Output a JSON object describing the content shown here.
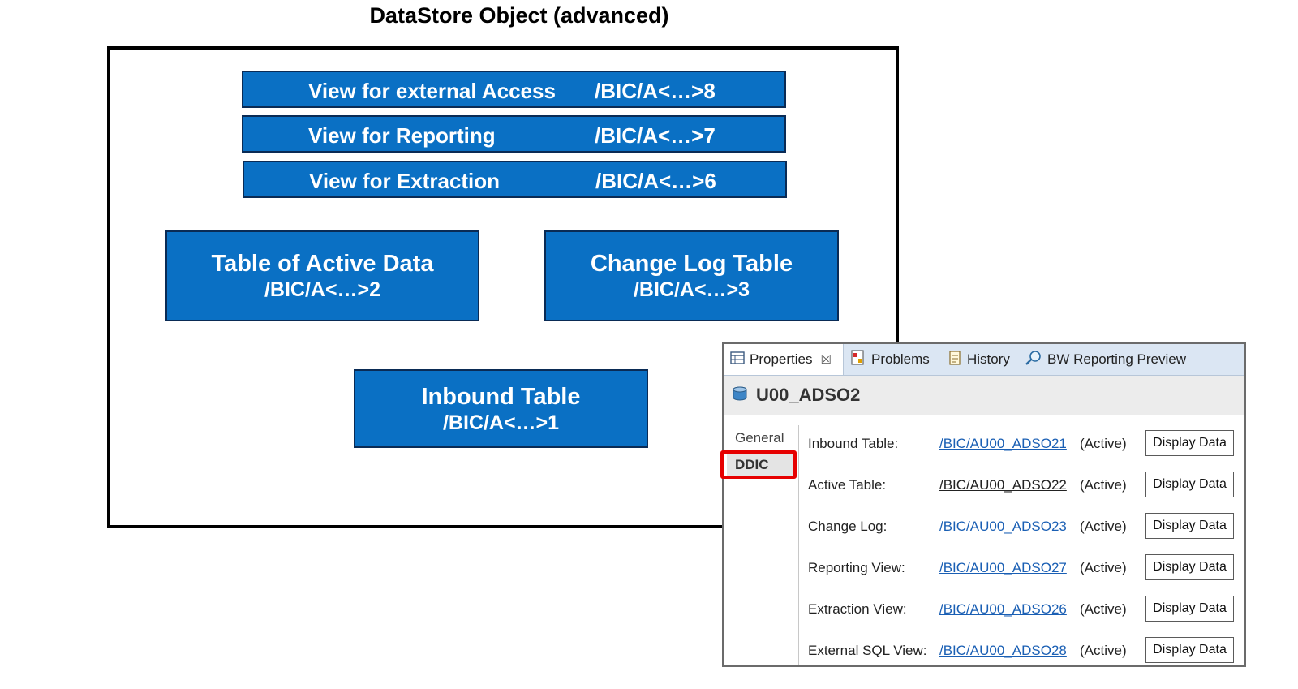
{
  "title": "DataStore Object (advanced)",
  "views": [
    {
      "label": "View for external Access",
      "code": "/BIC/A<…>8"
    },
    {
      "label": "View for Reporting",
      "code": "/BIC/A<…>7"
    },
    {
      "label": "View for Extraction",
      "code": "/BIC/A<…>6"
    }
  ],
  "tables": {
    "active": {
      "name": "Table of Active Data",
      "code": "/BIC/A<…>2"
    },
    "changelog": {
      "name": "Change Log Table",
      "code": "/BIC/A<…>3"
    },
    "inbound": {
      "name": "Inbound Table",
      "code": "/BIC/A<…>1"
    }
  },
  "panel": {
    "tabs": [
      {
        "label": "Properties",
        "icon": "properties-icon"
      },
      {
        "label": "Problems",
        "icon": "problems-icon"
      },
      {
        "label": "History",
        "icon": "history-icon"
      },
      {
        "label": "BW Reporting Preview",
        "icon": "reporting-preview-icon"
      }
    ],
    "close_glyph": "☒",
    "object_name": "U00_ADSO2",
    "side_tabs": [
      "General",
      "DDIC"
    ],
    "selected_side_tab": "DDIC",
    "rows": [
      {
        "label": "Inbound Table:",
        "link": "/BIC/AU00_ADSO21",
        "status": "(Active)",
        "button": "Display Data"
      },
      {
        "label": "Active Table:",
        "link": "/BIC/AU00_ADSO22",
        "status": "(Active)",
        "button": "Display Data"
      },
      {
        "label": "Change Log:",
        "link": "/BIC/AU00_ADSO23",
        "status": "(Active)",
        "button": "Display Data"
      },
      {
        "label": "Reporting View:",
        "link": "/BIC/AU00_ADSO27",
        "status": "(Active)",
        "button": "Display Data"
      },
      {
        "label": "Extraction View:",
        "link": "/BIC/AU00_ADSO26",
        "status": "(Active)",
        "button": "Display Data"
      },
      {
        "label": "External SQL View:",
        "link": "/BIC/AU00_ADSO28",
        "status": "(Active)",
        "button": "Display Data"
      }
    ]
  },
  "colors": {
    "box_fill": "#0a70c4",
    "box_border": "#0a2b55",
    "highlight": "#e60000",
    "link": "#1a5fb4"
  }
}
